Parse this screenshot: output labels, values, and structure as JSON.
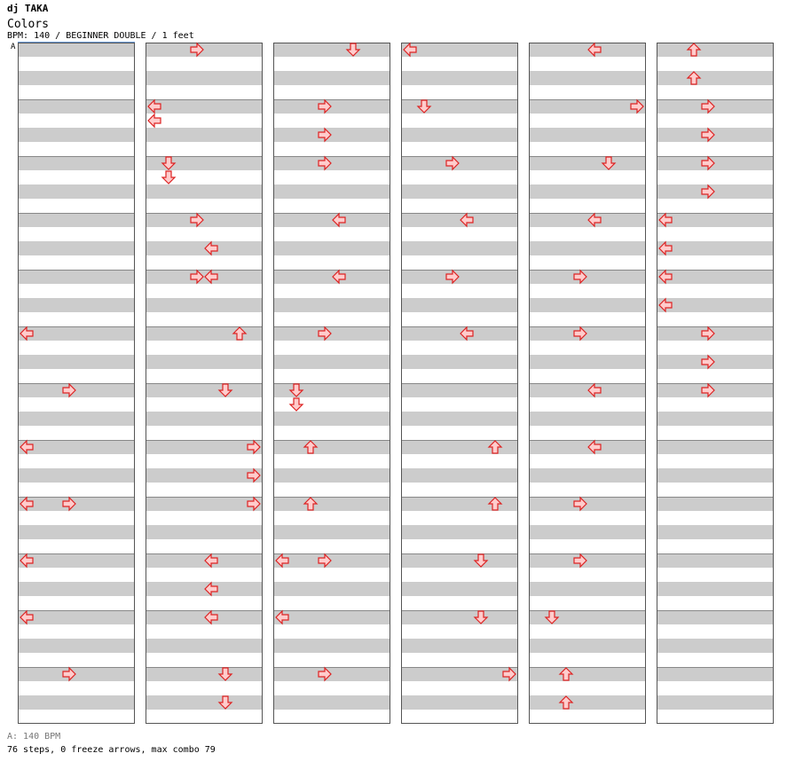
{
  "header": {
    "artist": "dj TAKA",
    "title": "Colors",
    "info": "BPM: 140 / BEGINNER DOUBLE / 1 feet",
    "bpm_marker": "A"
  },
  "footer": {
    "bpm_legend": "A: 140 BPM",
    "stats": "76 steps, 0 freeze arrows, max combo 79"
  },
  "colors": {
    "stripe": "#cccccc",
    "arrow_fill": "#ffcccc",
    "arrow_stroke": "#dd2222",
    "border": "#555555",
    "bpm_line": "#6a9ad8"
  },
  "chart_data": {
    "type": "step-chart",
    "panels_per_feet": [
      "left",
      "down",
      "up",
      "right",
      "left",
      "down",
      "up",
      "right"
    ],
    "measures_per_column": 12,
    "columns": 6,
    "rows_per_measure": 4,
    "notes": [
      [
        12,
        0,
        0,
        "left"
      ],
      [
        12,
        1,
        0,
        "right"
      ],
      [
        13,
        0,
        0,
        "left"
      ],
      [
        13,
        0,
        1,
        "left"
      ],
      [
        14,
        0,
        0,
        "down"
      ],
      [
        14,
        0,
        1,
        "down"
      ],
      [
        15,
        0,
        0,
        "right"
      ],
      [
        15,
        0,
        2,
        "left"
      ],
      [
        16,
        0,
        0,
        "right"
      ],
      [
        16,
        0,
        0,
        "left"
      ],
      [
        17,
        0,
        0,
        "up"
      ],
      [
        18,
        0,
        0,
        "down"
      ],
      [
        19,
        0,
        0,
        "right"
      ],
      [
        19,
        0,
        2,
        "right"
      ],
      [
        20,
        0,
        0,
        "right"
      ],
      [
        21,
        0,
        0,
        "left"
      ],
      [
        21,
        0,
        2,
        "left"
      ],
      [
        22,
        0,
        0,
        "left"
      ],
      [
        22,
        0,
        0,
        "left"
      ],
      [
        23,
        0,
        0,
        "down"
      ],
      [
        23,
        0,
        3,
        "down"
      ],
      [
        0,
        0,
        0,
        "left"
      ],
      [
        6,
        0,
        0,
        "right"
      ],
      [
        7,
        0,
        0,
        "left"
      ],
      [
        8,
        0,
        0,
        "left"
      ],
      [
        8,
        0,
        0,
        "right"
      ],
      [
        9,
        0,
        0,
        "left"
      ],
      [
        10,
        0,
        0,
        "left"
      ],
      [
        11,
        0,
        0,
        "right"
      ]
    ]
  }
}
